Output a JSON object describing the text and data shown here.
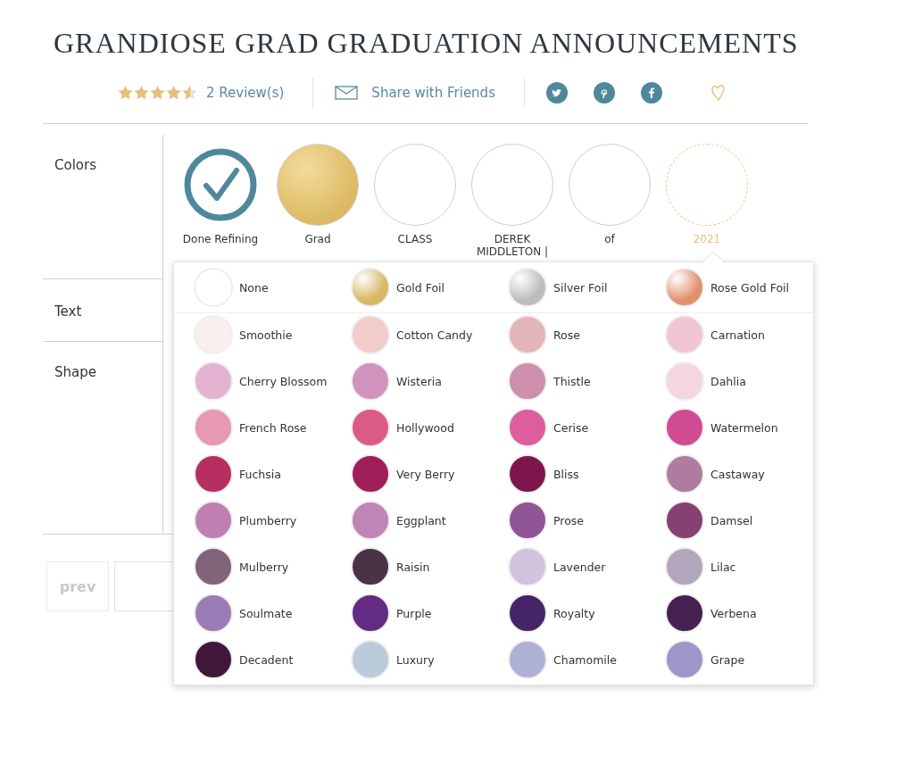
{
  "title": "GRANDIOSE GRAD GRADUATION ANNOUNCEMENTS",
  "rating": {
    "stars": 4.5,
    "reviews": "2 Review(s)"
  },
  "share": {
    "label": "Share with Friends"
  },
  "sections": [
    {
      "label": "Colors"
    },
    {
      "label": "Text"
    },
    {
      "label": "Shape"
    }
  ],
  "layers": [
    {
      "label": "Done Refining",
      "kind": "done",
      "selected": false
    },
    {
      "label": "Grad",
      "kind": "layer",
      "color": "#dcb962",
      "selected": false
    },
    {
      "label": "CLASS",
      "kind": "layer",
      "selected": false
    },
    {
      "label": "DEREK MIDDLETON |",
      "kind": "layer",
      "selected": false
    },
    {
      "label": "of",
      "kind": "layer",
      "selected": false
    },
    {
      "label": "2021",
      "kind": "layer",
      "selected": true
    }
  ],
  "palette": {
    "foils": [
      {
        "name": "None",
        "kind": "none",
        "color": "#ffffff"
      },
      {
        "name": "Gold Foil",
        "kind": "foil",
        "color": "#d8b865"
      },
      {
        "name": "Silver Foil",
        "kind": "foil",
        "color": "#bdbdbd"
      },
      {
        "name": "Rose Gold Foil",
        "kind": "foil",
        "color": "#e0926f"
      }
    ],
    "colors": [
      {
        "name": "Smoothie",
        "color": "#fbeeee"
      },
      {
        "name": "Cotton Candy",
        "color": "#f2cbcb"
      },
      {
        "name": "Rose",
        "color": "#e3b5bb"
      },
      {
        "name": "Carnation",
        "color": "#f0c6d6"
      },
      {
        "name": "Cherry Blossom",
        "color": "#e4b2d0"
      },
      {
        "name": "Wisteria",
        "color": "#d193bd"
      },
      {
        "name": "Thistle",
        "color": "#cd8fab"
      },
      {
        "name": "Dahlia",
        "color": "#f3d6e0"
      },
      {
        "name": "French Rose",
        "color": "#e698b4"
      },
      {
        "name": "Hollywood",
        "color": "#dc5a87"
      },
      {
        "name": "Cerise",
        "color": "#dc5e9d"
      },
      {
        "name": "Watermelon",
        "color": "#d14b93"
      },
      {
        "name": "Fuchsia",
        "color": "#b72f61"
      },
      {
        "name": "Very Berry",
        "color": "#a11f59"
      },
      {
        "name": "Bliss",
        "color": "#7c164c"
      },
      {
        "name": "Castaway",
        "color": "#b07ba0"
      },
      {
        "name": "Plumberry",
        "color": "#c07fb2"
      },
      {
        "name": "Eggplant",
        "color": "#c084b6"
      },
      {
        "name": "Prose",
        "color": "#8f5596"
      },
      {
        "name": "Damsel",
        "color": "#844171"
      },
      {
        "name": "Mulberry",
        "color": "#81637a"
      },
      {
        "name": "Raisin",
        "color": "#4a3346"
      },
      {
        "name": "Lavender",
        "color": "#cfc3dd"
      },
      {
        "name": "Lilac",
        "color": "#b2a6bc"
      },
      {
        "name": "Soulmate",
        "color": "#9b7cb7"
      },
      {
        "name": "Purple",
        "color": "#632b84"
      },
      {
        "name": "Royalty",
        "color": "#452468"
      },
      {
        "name": "Verbena",
        "color": "#46214f"
      },
      {
        "name": "Decadent",
        "color": "#42173c"
      },
      {
        "name": "Luxury",
        "color": "#bccbdc"
      },
      {
        "name": "Chamomile",
        "color": "#adb2d3"
      },
      {
        "name": "Grape",
        "color": "#9f95c8"
      }
    ]
  },
  "pager": {
    "prev": "prev"
  }
}
